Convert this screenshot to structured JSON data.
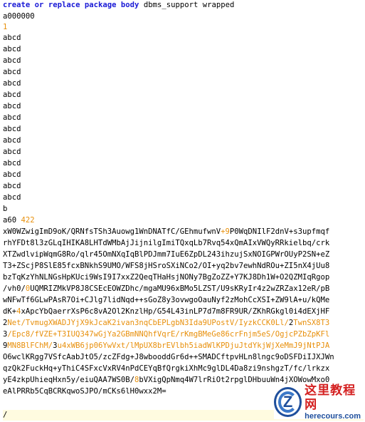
{
  "editor": {
    "header": {
      "kw1": "create",
      "kw2": "or",
      "kw3": "replace",
      "kw4": "package",
      "kw5": "body",
      "rest": "dbms_support wrapped"
    },
    "lines": {
      "l2": "a000000",
      "l3": "1",
      "abcd": "abcd",
      "b": "b",
      "a60_prefix": "a60 ",
      "a60_num": "422"
    },
    "blob": [
      [
        "xW0WZwigImD9oK/QRNfsTSh3Auowg1WnDNATfC/GEhmufwnV",
        "+9",
        "P0WqDNIlF2dnV+s3upfmqf"
      ],
      [
        "rhYFDt8l3zGLqIHIKA8LHTdWMbAjJijnilgImiTQxqLb7Rvq54xQmAIxVWQyRRkielbq/crk"
      ],
      [
        "XTZwdlvipWqmG8Ro/qlr45OmNXqIqBlPDJmm7IuE6ZpDL243ihzujSxNOIGPWrOUyP2SN+eZ"
      ],
      [
        "T3+ZScjP8SlE85fcxBNkhS9UMO/WFS8jHSroSXiNCo2/OI+yq2bv7ewhNdROu+ZI5nX4jUu8"
      ],
      [
        "bzTqKzYhNLNGsHpKUci9WsI9I7xxZ2QeqTHaHsjNONy7BgZoZZ+Y7KJ8Dh1W+O2QZMIqRgop"
      ],
      [
        "/vh0/",
        "0",
        "UQMRIZMkVP8J8CSEcEOWZDhc/mgaMU96xBMo5LZST/U9sKRyIr4z2wZRZax12eR/pB"
      ],
      [
        "wNFwTf6GLwPAsR7Oi+CJlg7lidNqd++sGoZ8y3ovwgoOauNyf2zMohCcXSI+ZW9lA+u/kQMe"
      ],
      [
        "dK+",
        "4",
        "xApcYbQaerrXsP6c8vA2Ol2KnzlHp/G54L43inLP7d7m8FR9UR/ZKhRGkgl0i4dEXjHF"
      ],
      [
        "2",
        "Net/TvmugXWADJYjX9kJcaK2ivan3nqCbEPLgbN3Ida9UPostV/IyzkCCK0Ll/",
        "2",
        "TwnSX8T3"
      ],
      [
        "3",
        "/Epc8/fVZE+T3IUQ347wGjYa2GBmNNQhfVqrE/rKmgBMeGe86crFnjm5eS/OgjcPZbZpKFl"
      ],
      [
        "9",
        "MN8BlFChM/",
        "3",
        "u4xWB6jp06YwVxt/lMpUX8brEVlbh5iadWlKPDjuJtdYkjWjXeMmJ9jNtPJA"
      ],
      [
        "O6wclKRgg7VSfcAabJtO5/zcZFdg+J8wbooddGr6d++SMADCftpvHLn8lngc9oDSFDiIJXJWn"
      ],
      [
        "qzQk2FuckHq+yThiC4SFxcVxRV4nPdCEYqBfQrgkiXhMc9glDL4Da8zi9nshgzT/fc/lrkzx"
      ],
      [
        "yE4zkpUhieqHxn5y/eiuQAA7WS0B/",
        "8",
        "bVXigQpNmq4W7lrRiOt2rpglDHbuuWn4jXOWowMxo0"
      ],
      [
        "eAlPRRb5CqBCRKqwoSJPO/mCKs6lH0wxx2M="
      ]
    ],
    "slash": "/"
  },
  "watermark": {
    "logo_letter": "Z",
    "title": "这里教程网",
    "url": "herecours.com"
  },
  "colors": {
    "keyword": "#1a1ad6",
    "number": "#e8900c",
    "text": "#000000",
    "current_line": "#fffbe0"
  }
}
